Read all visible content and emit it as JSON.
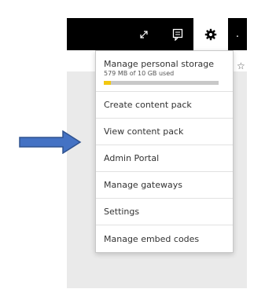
{
  "toolbar": {
    "expand_icon": "expand-icon",
    "feedback_icon": "feedback-icon",
    "settings_icon": "gear-icon",
    "more_label": "."
  },
  "menu": {
    "storage": {
      "title": "Manage personal storage",
      "usage": "579 MB of 10 GB used",
      "used_fraction": 0.06
    },
    "items": [
      {
        "label": "Create content pack"
      },
      {
        "label": "View content pack"
      },
      {
        "label": "Admin Portal"
      },
      {
        "label": "Manage gateways"
      },
      {
        "label": "Settings"
      },
      {
        "label": "Manage embed codes"
      }
    ]
  },
  "colors": {
    "topbar": "#000000",
    "storage_fill": "#f2c811",
    "arrow": "#4472c4"
  },
  "annotation": {
    "icon": "pointer-arrow-icon"
  }
}
